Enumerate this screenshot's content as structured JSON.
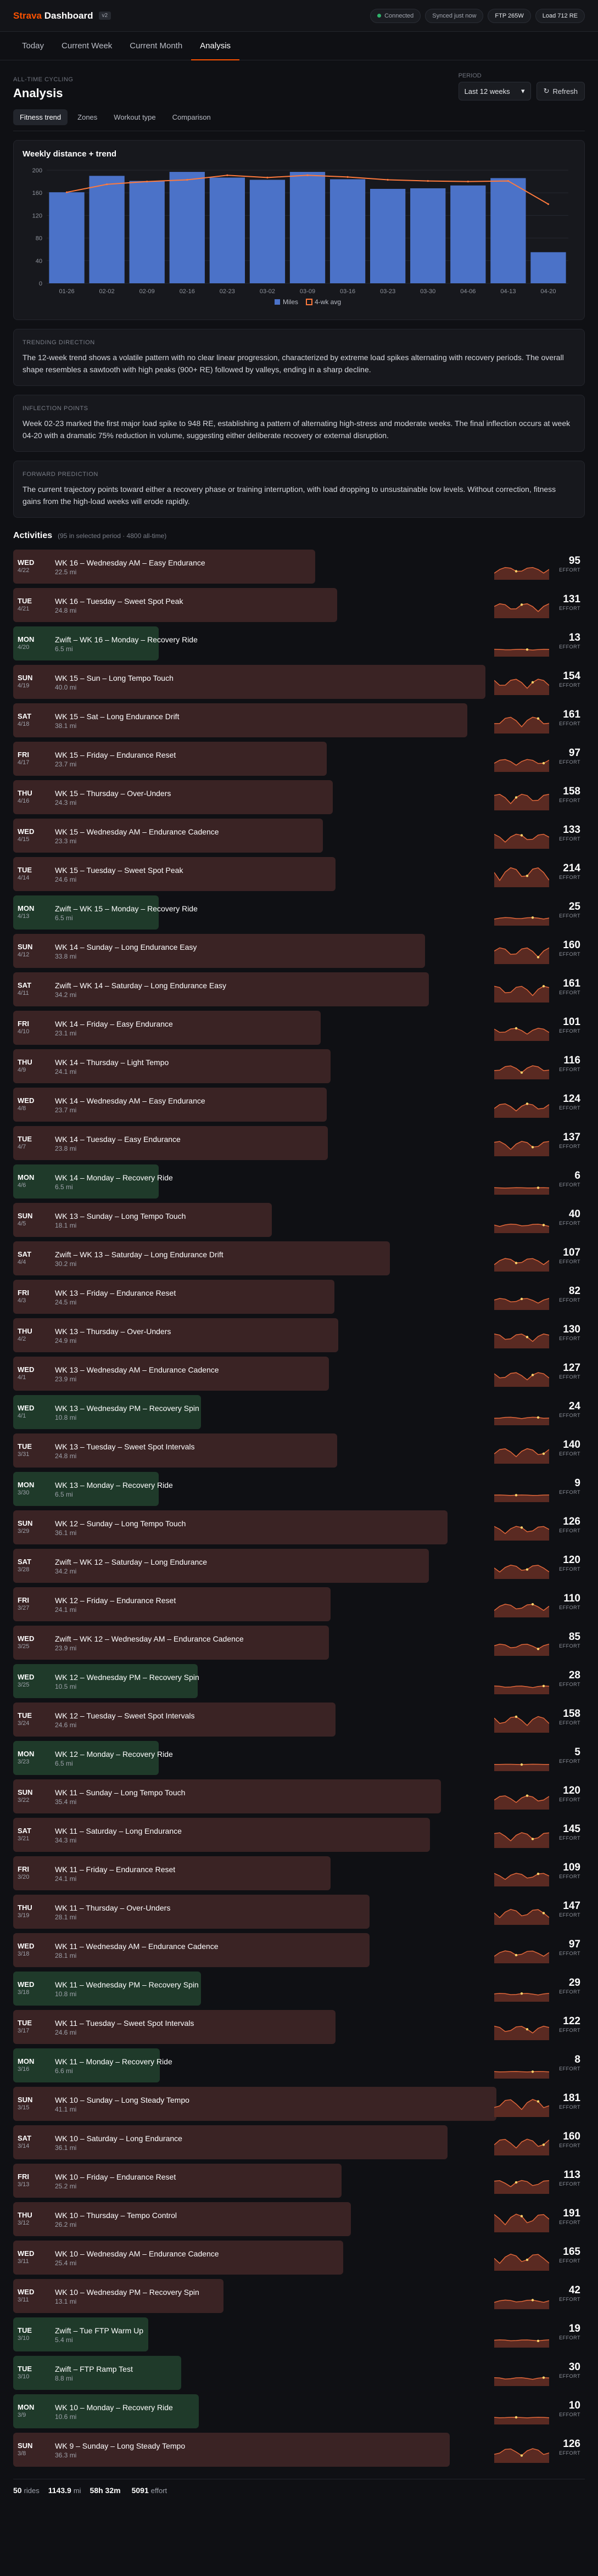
{
  "app": {
    "brand_strava": "Strava",
    "brand_dashboard": "Dashboard",
    "version": "v2"
  },
  "status": {
    "connected": "Connected",
    "synced": "Synced just now",
    "ftp": "FTP 265W",
    "load": "Load 712 RE"
  },
  "nav": {
    "tabs": [
      "Today",
      "Current Week",
      "Current Month",
      "Analysis"
    ],
    "active": "Analysis"
  },
  "page": {
    "kicker": "ALL-TIME CYCLING",
    "title": "Analysis"
  },
  "period": {
    "label": "PERIOD",
    "value": "Last 12 weeks",
    "refresh": "Refresh"
  },
  "subtabs": {
    "items": [
      "Fitness trend",
      "Zones",
      "Workout type",
      "Comparison"
    ],
    "active": "Fitness trend"
  },
  "chart_data": {
    "type": "bar",
    "title": "Weekly distance + trend",
    "categories": [
      "01-26",
      "02-02",
      "02-09",
      "02-16",
      "02-23",
      "03-02",
      "03-09",
      "03-16",
      "03-23",
      "03-30",
      "04-06",
      "04-13",
      "04-20"
    ],
    "series": [
      {
        "name": "Miles",
        "kind": "bar",
        "values": [
          161,
          190,
          181,
          197,
          187,
          183,
          197,
          184,
          167,
          168,
          173,
          186,
          55
        ]
      },
      {
        "name": "4-wk avg",
        "kind": "line",
        "values": [
          161,
          175,
          180,
          183,
          191,
          187,
          191,
          188,
          183,
          181,
          180,
          181,
          140
        ]
      }
    ],
    "yticks": [
      0,
      40,
      80,
      120,
      160,
      200
    ],
    "ylim": [
      0,
      200
    ],
    "grid": true,
    "legend": "bottom-center",
    "colors": {
      "bar": "#4b72c8",
      "line": "#ff7a3d"
    }
  },
  "insights": [
    {
      "kicker": "TRENDING DIRECTION",
      "text": "The 12-week trend shows a volatile pattern with no clear linear progression, characterized by extreme load spikes alternating with recovery periods. The overall shape resembles a sawtooth with high peaks (900+ RE) followed by valleys, ending in a sharp decline."
    },
    {
      "kicker": "INFLECTION POINTS",
      "text": "Week 02-23 marked the first major load spike to 948 RE, establishing a pattern of alternating high-stress and moderate weeks. The final inflection occurs at week 04-20 with a dramatic 75% reduction in volume, suggesting either deliberate recovery or external disruption."
    },
    {
      "kicker": "FORWARD PREDICTION",
      "text": "The current trajectory points toward either a recovery phase or training interruption, with load dropping to unsustainable low levels. Without correction, fitness gains from the high-load weeks will erode rapidly."
    }
  ],
  "activities_header": {
    "title": "Activities",
    "subtitle": "(95 in selected period · 4800 all-time)"
  },
  "effort_label": "EFFORT",
  "activities": [
    {
      "day": "WED",
      "date": "4/22",
      "name": "WK 16 – Wednesday AM – Easy Endurance",
      "dist": "22.5 mi",
      "effort": "95",
      "rec": false
    },
    {
      "day": "TUE",
      "date": "4/21",
      "name": "WK 16 – Tuesday – Sweet Spot Peak",
      "dist": "24.8 mi",
      "effort": "131",
      "rec": false
    },
    {
      "day": "MON",
      "date": "4/20",
      "name": "Zwift – WK 16 – Monday – Recovery Ride",
      "dist": "6.5 mi",
      "effort": "13",
      "rec": true
    },
    {
      "day": "SUN",
      "date": "4/19",
      "name": "WK 15 – Sun – Long Tempo Touch",
      "dist": "40.0 mi",
      "effort": "154",
      "rec": false
    },
    {
      "day": "SAT",
      "date": "4/18",
      "name": "WK 15 – Sat – Long Endurance Drift",
      "dist": "38.1 mi",
      "effort": "161",
      "rec": false
    },
    {
      "day": "FRI",
      "date": "4/17",
      "name": "WK 15 – Friday – Endurance Reset",
      "dist": "23.7 mi",
      "effort": "97",
      "rec": false
    },
    {
      "day": "THU",
      "date": "4/16",
      "name": "WK 15 – Thursday – Over-Unders",
      "dist": "24.3 mi",
      "effort": "158",
      "rec": false
    },
    {
      "day": "WED",
      "date": "4/15",
      "name": "WK 15 – Wednesday AM – Endurance Cadence",
      "dist": "23.3 mi",
      "effort": "133",
      "rec": false
    },
    {
      "day": "TUE",
      "date": "4/14",
      "name": "WK 15 – Tuesday – Sweet Spot Peak",
      "dist": "24.6 mi",
      "effort": "214",
      "rec": false
    },
    {
      "day": "MON",
      "date": "4/13",
      "name": "Zwift – WK 15 – Monday – Recovery Ride",
      "dist": "6.5 mi",
      "effort": "25",
      "rec": true
    },
    {
      "day": "SUN",
      "date": "4/12",
      "name": "WK 14 – Sunday – Long Endurance Easy",
      "dist": "33.8 mi",
      "effort": "160",
      "rec": false
    },
    {
      "day": "SAT",
      "date": "4/11",
      "name": "Zwift – WK 14 – Saturday – Long Endurance Easy",
      "dist": "34.2 mi",
      "effort": "161",
      "rec": false
    },
    {
      "day": "FRI",
      "date": "4/10",
      "name": "WK 14 – Friday – Easy Endurance",
      "dist": "23.1 mi",
      "effort": "101",
      "rec": false
    },
    {
      "day": "THU",
      "date": "4/9",
      "name": "WK 14 – Thursday – Light Tempo",
      "dist": "24.1 mi",
      "effort": "116",
      "rec": false
    },
    {
      "day": "WED",
      "date": "4/8",
      "name": "WK 14 – Wednesday AM – Easy Endurance",
      "dist": "23.7 mi",
      "effort": "124",
      "rec": false
    },
    {
      "day": "TUE",
      "date": "4/7",
      "name": "WK 14 – Tuesday – Easy Endurance",
      "dist": "23.8 mi",
      "effort": "137",
      "rec": false
    },
    {
      "day": "MON",
      "date": "4/6",
      "name": "WK 14 – Monday – Recovery Ride",
      "dist": "6.5 mi",
      "effort": "6",
      "rec": true
    },
    {
      "day": "SUN",
      "date": "4/5",
      "name": "WK 13 – Sunday – Long Tempo Touch",
      "dist": "18.1 mi",
      "effort": "40",
      "rec": false
    },
    {
      "day": "SAT",
      "date": "4/4",
      "name": "Zwift – WK 13 – Saturday – Long Endurance Drift",
      "dist": "30.2 mi",
      "effort": "107",
      "rec": false
    },
    {
      "day": "FRI",
      "date": "4/3",
      "name": "WK 13 – Friday – Endurance Reset",
      "dist": "24.5 mi",
      "effort": "82",
      "rec": false
    },
    {
      "day": "THU",
      "date": "4/2",
      "name": "WK 13 – Thursday – Over-Unders",
      "dist": "24.9 mi",
      "effort": "130",
      "rec": false
    },
    {
      "day": "WED",
      "date": "4/1",
      "name": "WK 13 – Wednesday AM – Endurance Cadence",
      "dist": "23.9 mi",
      "effort": "127",
      "rec": false
    },
    {
      "day": "WED",
      "date": "4/1",
      "name": "WK 13 – Wednesday PM – Recovery Spin",
      "dist": "10.8 mi",
      "effort": "24",
      "rec": true
    },
    {
      "day": "TUE",
      "date": "3/31",
      "name": "WK 13 – Tuesday – Sweet Spot Intervals",
      "dist": "24.8 mi",
      "effort": "140",
      "rec": false
    },
    {
      "day": "MON",
      "date": "3/30",
      "name": "WK 13 – Monday – Recovery Ride",
      "dist": "6.5 mi",
      "effort": "9",
      "rec": true
    },
    {
      "day": "SUN",
      "date": "3/29",
      "name": "WK 12 – Sunday – Long Tempo Touch",
      "dist": "36.1 mi",
      "effort": "126",
      "rec": false
    },
    {
      "day": "SAT",
      "date": "3/28",
      "name": "Zwift – WK 12 – Saturday – Long Endurance",
      "dist": "34.2 mi",
      "effort": "120",
      "rec": false
    },
    {
      "day": "FRI",
      "date": "3/27",
      "name": "WK 12 – Friday – Endurance Reset",
      "dist": "24.1 mi",
      "effort": "110",
      "rec": false
    },
    {
      "day": "WED",
      "date": "3/25",
      "name": "Zwift – WK 12 – Wednesday AM – Endurance Cadence",
      "dist": "23.9 mi",
      "effort": "85",
      "rec": false
    },
    {
      "day": "WED",
      "date": "3/25",
      "name": "WK 12 – Wednesday PM – Recovery Spin",
      "dist": "10.5 mi",
      "effort": "28",
      "rec": true
    },
    {
      "day": "TUE",
      "date": "3/24",
      "name": "WK 12 – Tuesday – Sweet Spot Intervals",
      "dist": "24.6 mi",
      "effort": "158",
      "rec": false
    },
    {
      "day": "MON",
      "date": "3/23",
      "name": "WK 12 – Monday – Recovery Ride",
      "dist": "6.5 mi",
      "effort": "5",
      "rec": true
    },
    {
      "day": "SUN",
      "date": "3/22",
      "name": "WK 11 – Sunday – Long Tempo Touch",
      "dist": "35.4 mi",
      "effort": "120",
      "rec": false
    },
    {
      "day": "SAT",
      "date": "3/21",
      "name": "WK 11 – Saturday – Long Endurance",
      "dist": "34.3 mi",
      "effort": "145",
      "rec": false
    },
    {
      "day": "FRI",
      "date": "3/20",
      "name": "WK 11 – Friday – Endurance Reset",
      "dist": "24.1 mi",
      "effort": "109",
      "rec": false
    },
    {
      "day": "THU",
      "date": "3/19",
      "name": "WK 11 – Thursday – Over-Unders",
      "dist": "28.1 mi",
      "effort": "147",
      "rec": false
    },
    {
      "day": "WED",
      "date": "3/18",
      "name": "WK 11 – Wednesday AM – Endurance Cadence",
      "dist": "28.1 mi",
      "effort": "97",
      "rec": false
    },
    {
      "day": "WED",
      "date": "3/18",
      "name": "WK 11 – Wednesday PM – Recovery Spin",
      "dist": "10.8 mi",
      "effort": "29",
      "rec": true
    },
    {
      "day": "TUE",
      "date": "3/17",
      "name": "WK 11 – Tuesday – Sweet Spot Intervals",
      "dist": "24.6 mi",
      "effort": "122",
      "rec": false
    },
    {
      "day": "MON",
      "date": "3/16",
      "name": "WK 11 – Monday – Recovery Ride",
      "dist": "6.6 mi",
      "effort": "8",
      "rec": true
    },
    {
      "day": "SUN",
      "date": "3/15",
      "name": "WK 10 – Sunday – Long Steady Tempo",
      "dist": "41.1 mi",
      "effort": "181",
      "rec": false
    },
    {
      "day": "SAT",
      "date": "3/14",
      "name": "WK 10 – Saturday – Long Endurance",
      "dist": "36.1 mi",
      "effort": "160",
      "rec": false
    },
    {
      "day": "FRI",
      "date": "3/13",
      "name": "WK 10 – Friday – Endurance Reset",
      "dist": "25.2 mi",
      "effort": "113",
      "rec": false
    },
    {
      "day": "THU",
      "date": "3/12",
      "name": "WK 10 – Thursday – Tempo Control",
      "dist": "26.2 mi",
      "effort": "191",
      "rec": false
    },
    {
      "day": "WED",
      "date": "3/11",
      "name": "WK 10 – Wednesday AM – Endurance Cadence",
      "dist": "25.4 mi",
      "effort": "165",
      "rec": false
    },
    {
      "day": "WED",
      "date": "3/11",
      "name": "WK 10 – Wednesday PM – Recovery Spin",
      "dist": "13.1 mi",
      "effort": "42",
      "rec": false
    },
    {
      "day": "TUE",
      "date": "3/10",
      "name": "Zwift – Tue FTP Warm Up",
      "dist": "5.4 mi",
      "effort": "19",
      "rec": true
    },
    {
      "day": "TUE",
      "date": "3/10",
      "name": "Zwift – FTP Ramp Test",
      "dist": "8.8 mi",
      "effort": "30",
      "rec": true
    },
    {
      "day": "MON",
      "date": "3/9",
      "name": "WK 10 – Monday – Recovery Ride",
      "dist": "10.6 mi",
      "effort": "10",
      "rec": true
    },
    {
      "day": "SUN",
      "date": "3/8",
      "name": "WK 9 – Sunday – Long Steady Tempo",
      "dist": "36.3 mi",
      "effort": "126",
      "rec": false
    }
  ],
  "footer": {
    "rides_val": "50",
    "rides_lbl": "rides",
    "mi_val": "1143.9",
    "mi_lbl": "mi",
    "time_val": "58h 32m",
    "effort_val": "5091",
    "effort_lbl": "effort"
  }
}
